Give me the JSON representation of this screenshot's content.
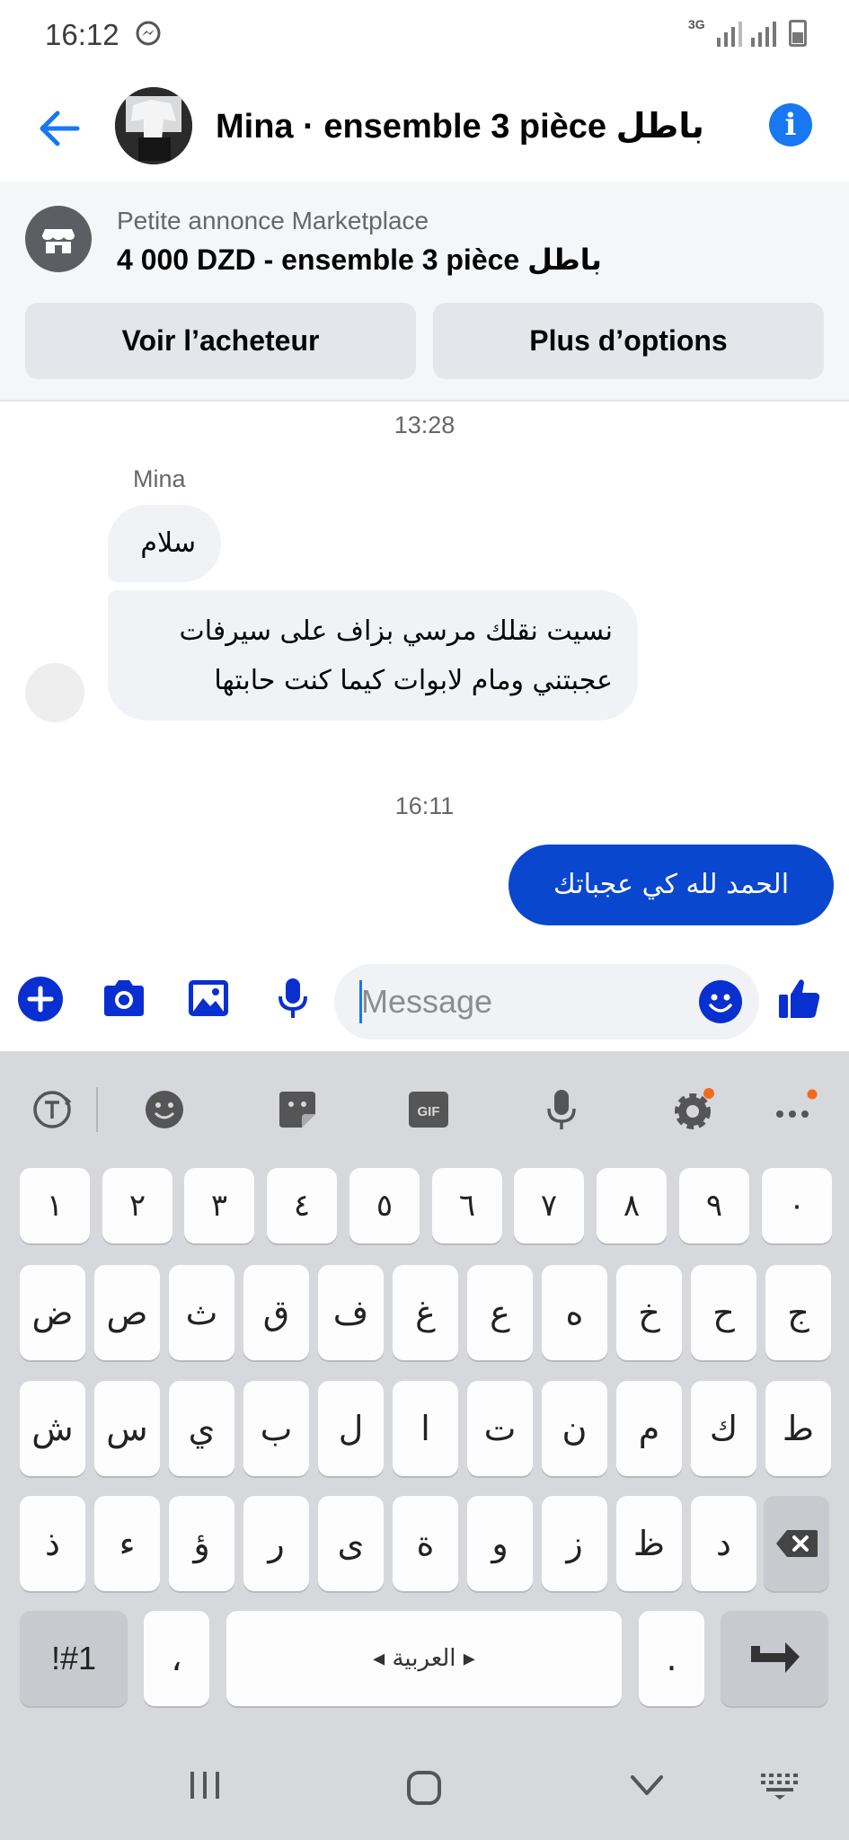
{
  "status_bar": {
    "time": "16:12",
    "network": "3G"
  },
  "header": {
    "title": "Mina · ensemble 3 pièce باطل"
  },
  "marketplace": {
    "subtitle": "Petite annonce Marketplace",
    "title": "4 000 DZD - ensemble 3 pièce باطل",
    "view_buyer_label": "Voir l’acheteur",
    "more_options_label": "Plus d’options"
  },
  "conversation": {
    "timestamp_1": "13:28",
    "sender_name": "Mina",
    "messages_in": [
      "سلام",
      "نسيت نقلك مرسي بزاف على سيرفات عجبتني ومام لابوات كيما كنت حابتها"
    ],
    "timestamp_2": "16:11",
    "message_out": "الحمد لله كي عجباتك"
  },
  "composer": {
    "placeholder": "Message"
  },
  "keyboard": {
    "row1": [
      "١",
      "٢",
      "٣",
      "٤",
      "٥",
      "٦",
      "٧",
      "٨",
      "٩",
      "٠"
    ],
    "row2": [
      "ض",
      "ص",
      "ث",
      "ق",
      "ف",
      "غ",
      "ع",
      "ه",
      "خ",
      "ح",
      "ج"
    ],
    "row3": [
      "ش",
      "س",
      "ي",
      "ب",
      "ل",
      "ا",
      "ت",
      "ن",
      "م",
      "ك",
      "ط"
    ],
    "row4": [
      "ذ",
      "ء",
      "ؤ",
      "ر",
      "ى",
      "ة",
      "و",
      "ز",
      "ظ",
      "د"
    ],
    "symbols_label": "!#1",
    "comma_label": "،",
    "space_label": "◂ العربية ▸",
    "period_label": "."
  },
  "colors": {
    "accent": "#1877f2",
    "outgoing_bubble": "#0a47cf",
    "incoming_bubble": "#f0f2f5",
    "icon_blue": "#0a2fd0",
    "keyboard_bg": "#d7d8dc"
  },
  "icons": {
    "header": [
      "back-arrow-icon",
      "avatar",
      "info-icon"
    ],
    "composer": [
      "plus-icon",
      "camera-icon",
      "image-icon",
      "mic-icon",
      "emoji-icon",
      "thumbs-up-icon"
    ],
    "keyboard_toolbar": [
      "translate-icon",
      "emoji-icon",
      "sticker-icon",
      "gif-icon",
      "mic-icon",
      "settings-icon",
      "more-icon"
    ],
    "nav": [
      "recents-icon",
      "home-icon",
      "back-icon",
      "keyboard-icon"
    ]
  }
}
